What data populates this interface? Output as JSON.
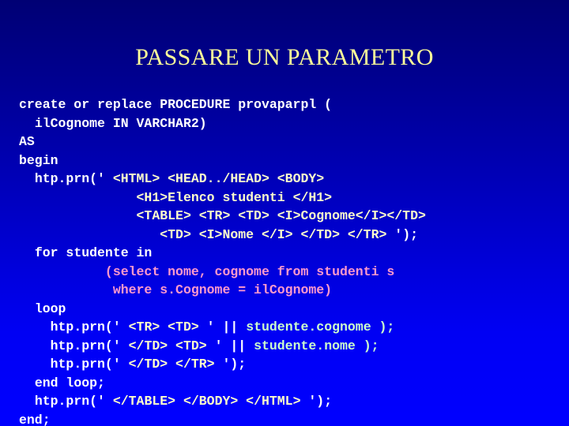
{
  "slide": {
    "title": "PASSARE UN PARAMETRO",
    "background": {
      "top_color": "#000074",
      "bottom_color": "#0000ff"
    },
    "title_color": "#ffff99"
  },
  "palette": {
    "plain": "#ffffff",
    "html_tag": "#ffffcc",
    "sql": "#ff99cc",
    "variable": "#ccffcc"
  },
  "code": {
    "language": "PL/SQL",
    "lines": [
      {
        "indent": 0,
        "tokens": [
          {
            "text": "create or replace ",
            "style": "plain"
          },
          {
            "text": "PROCEDURE provaparpl (",
            "style": "plain"
          }
        ]
      },
      {
        "indent": 2,
        "tokens": [
          {
            "text": "ilCognome IN VARCHAR2)",
            "style": "plain"
          }
        ]
      },
      {
        "indent": 0,
        "tokens": [
          {
            "text": "AS",
            "style": "plain"
          }
        ]
      },
      {
        "indent": 0,
        "tokens": [
          {
            "text": "begin",
            "style": "plain"
          }
        ]
      },
      {
        "indent": 2,
        "tokens": [
          {
            "text": "htp.prn(' ",
            "style": "plain"
          },
          {
            "text": "<HTML> <HEAD../HEAD> <BODY>",
            "style": "html_tag"
          }
        ]
      },
      {
        "indent": 15,
        "tokens": [
          {
            "text": "<H1>Elenco studenti </H1>",
            "style": "html_tag"
          }
        ]
      },
      {
        "indent": 15,
        "tokens": [
          {
            "text": "<TABLE> <TR> <TD> <I>Cognome</I></TD>",
            "style": "html_tag"
          }
        ]
      },
      {
        "indent": 18,
        "tokens": [
          {
            "text": "<TD> <I>Nome </I> </TD> </TR> ",
            "style": "html_tag"
          },
          {
            "text": "');",
            "style": "plain"
          }
        ]
      },
      {
        "indent": 2,
        "tokens": [
          {
            "text": "for studente in",
            "style": "plain"
          }
        ]
      },
      {
        "indent": 11,
        "tokens": [
          {
            "text": "(select nome, cognome from studenti s",
            "style": "sql"
          }
        ]
      },
      {
        "indent": 12,
        "tokens": [
          {
            "text": "where s.Cognome = ilCognome)",
            "style": "sql"
          }
        ]
      },
      {
        "indent": 2,
        "tokens": [
          {
            "text": "loop",
            "style": "plain"
          }
        ]
      },
      {
        "indent": 4,
        "tokens": [
          {
            "text": "htp.prn(' ",
            "style": "plain"
          },
          {
            "text": "<TR> <TD> ",
            "style": "html_tag"
          },
          {
            "text": "' || ",
            "style": "plain"
          },
          {
            "text": "studente.cognome );",
            "style": "variable"
          }
        ]
      },
      {
        "indent": 4,
        "tokens": [
          {
            "text": "htp.prn(' ",
            "style": "plain"
          },
          {
            "text": "</TD> <TD> ",
            "style": "html_tag"
          },
          {
            "text": "' || ",
            "style": "plain"
          },
          {
            "text": "studente.nome );",
            "style": "variable"
          }
        ]
      },
      {
        "indent": 4,
        "tokens": [
          {
            "text": "htp.prn(' ",
            "style": "plain"
          },
          {
            "text": "</TD> </TR> ",
            "style": "html_tag"
          },
          {
            "text": "');",
            "style": "plain"
          }
        ]
      },
      {
        "indent": 2,
        "tokens": [
          {
            "text": "end loop;",
            "style": "plain"
          }
        ]
      },
      {
        "indent": 2,
        "tokens": [
          {
            "text": "htp.prn(' ",
            "style": "plain"
          },
          {
            "text": "</TABLE> </BODY> </HTML> ",
            "style": "html_tag"
          },
          {
            "text": "');",
            "style": "plain"
          }
        ]
      },
      {
        "indent": 0,
        "tokens": [
          {
            "text": "end;",
            "style": "plain"
          }
        ]
      }
    ]
  }
}
